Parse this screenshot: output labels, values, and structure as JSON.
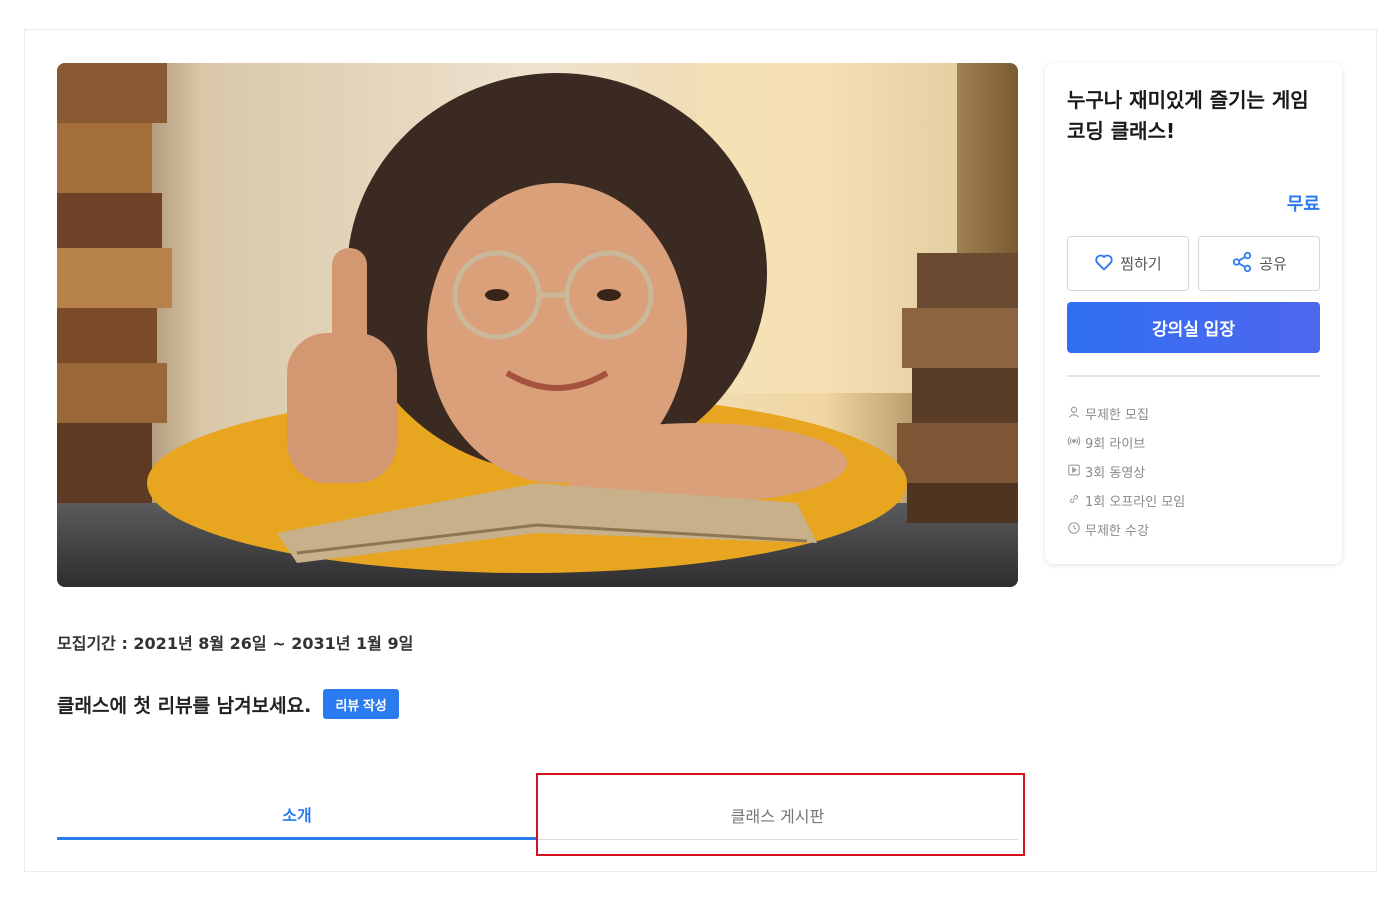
{
  "course": {
    "title": "누구나 재미있게 즐기는 게임 코딩 클래스!",
    "price": "무료",
    "period": "모집기간 : 2021년 8월 26일 ~ 2031년 1월 9일"
  },
  "actions": {
    "like_label": "찜하기",
    "share_label": "공유",
    "enter_label": "강의실 입장"
  },
  "features": [
    {
      "icon": "person-icon",
      "label": "무제한 모집"
    },
    {
      "icon": "live-icon",
      "label": "9회 라이브"
    },
    {
      "icon": "video-icon",
      "label": "3회 동영상"
    },
    {
      "icon": "link-icon",
      "label": "1회 오프라인 모임"
    },
    {
      "icon": "clock-icon",
      "label": "무제한 수강"
    }
  ],
  "review": {
    "prompt": "클래스에 첫 리뷰를 남겨보세요.",
    "button_label": "리뷰 작성"
  },
  "tabs": [
    {
      "label": "소개",
      "active": true
    },
    {
      "label": "클래스 게시판",
      "active": false
    }
  ],
  "colors": {
    "accent": "#2b7bf0",
    "highlight": "#d4121b"
  }
}
